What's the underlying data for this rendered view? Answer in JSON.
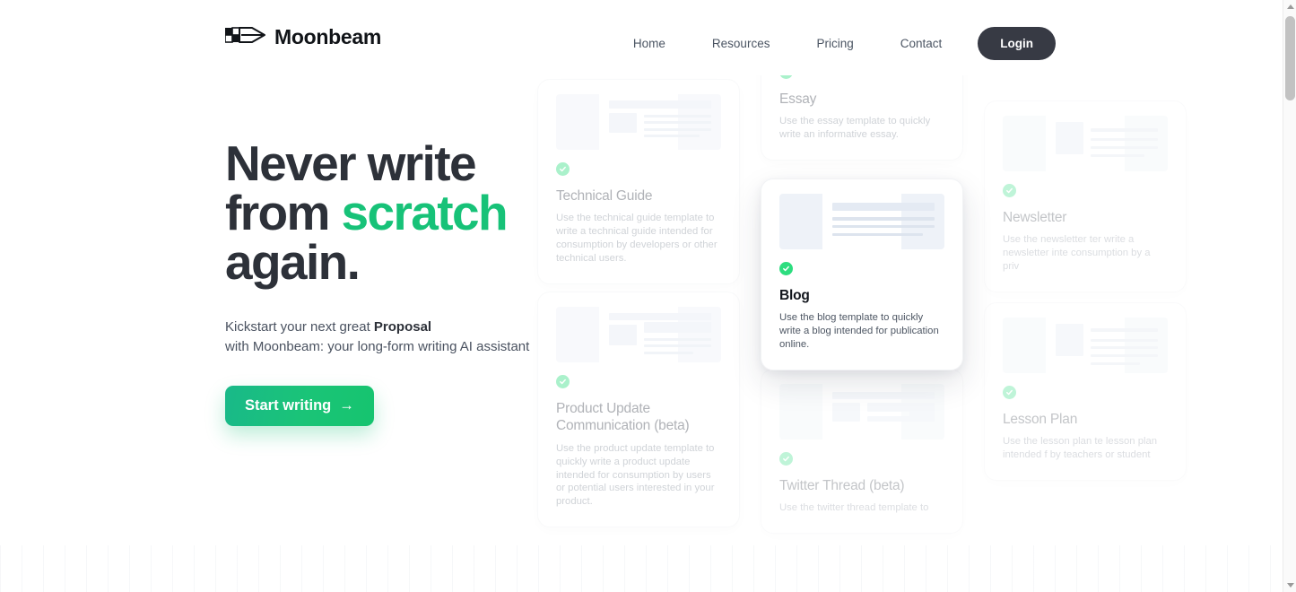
{
  "brand": {
    "name": "Moonbeam",
    "logo_icon": "pen-nib-icon"
  },
  "nav": {
    "links": [
      {
        "label": "Home"
      },
      {
        "label": "Resources"
      },
      {
        "label": "Pricing"
      },
      {
        "label": "Contact"
      }
    ],
    "login_label": "Login"
  },
  "hero": {
    "title_line1": "Never write",
    "title_line2_prefix": "from ",
    "title_line2_accent": "scratch",
    "title_line3": "again.",
    "sub_line1_prefix": "Kickstart your next great ",
    "sub_line1_bold": "Proposal",
    "sub_line2": "with Moonbeam: your long-form writing AI assistant",
    "cta_label": "Start writing",
    "cta_arrow": "→",
    "accent_color": "#17c278",
    "cta_color": "#1ac477"
  },
  "templates": {
    "column1": [
      {
        "title": "Technical Guide",
        "description": "Use the technical guide template to write a technical guide intended for consumption by developers or other technical users.",
        "badge_icon": "document-check-icon",
        "focused": false
      },
      {
        "title": "Product Update Communication (beta)",
        "description": "Use the product update template to quickly write a product update intended for consumption by users or potential users interested in your product.",
        "badge_icon": "document-check-icon",
        "focused": false
      }
    ],
    "column2": [
      {
        "title": "Essay",
        "description": "Use the essay template to quickly write an informative essay.",
        "badge_icon": "document-check-icon",
        "focused": false
      },
      {
        "title": "Blog",
        "description": "Use the blog template to quickly write a blog intended for publication online.",
        "badge_icon": "document-check-icon",
        "focused": true
      },
      {
        "title": "Twitter Thread (beta)",
        "description": "Use the twitter thread template to",
        "badge_icon": "document-check-icon",
        "focused": false
      }
    ],
    "column3": [
      {
        "title": "Newsletter",
        "description": "Use the newsletter ter write a newsletter inte consumption by a priv",
        "badge_icon": "document-check-icon",
        "focused": false
      },
      {
        "title": "Lesson Plan",
        "description": "Use the lesson plan te lesson plan intended f by teachers or student",
        "badge_icon": "document-check-icon",
        "focused": false
      }
    ]
  },
  "scrollbar": {
    "up_icon": "caret-up-icon",
    "down_icon": "caret-down-icon"
  }
}
